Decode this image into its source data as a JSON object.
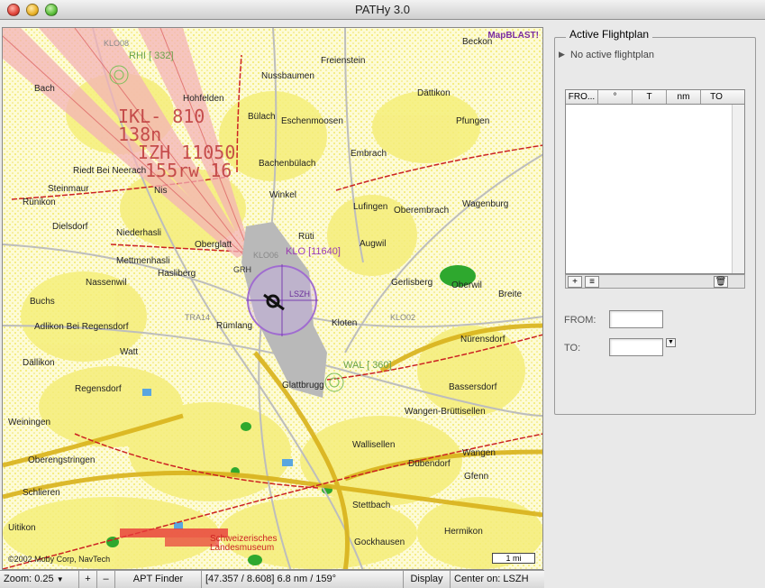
{
  "window": {
    "title": "PATHy 3.0"
  },
  "map": {
    "mapblast_logo": "MapBLAST!",
    "copyright": "©2002 Moby Corp, NavTech",
    "scale": "1 mi",
    "flight_labels": [
      "IKL- 810",
      "138n",
      "IZH 11050",
      "155rw 16"
    ],
    "navaids": [
      {
        "label": "RHI [ 332]"
      },
      {
        "label": "KLO [11640]"
      },
      {
        "label": "WAL [ 360]"
      }
    ],
    "waypoints": [
      "KLO08",
      "KLO06",
      "TRA14",
      "KLO02",
      "LSZH",
      "GRH"
    ],
    "places": [
      "Beckon",
      "Freienstein",
      "Nussbaumen",
      "Dättikon",
      "Bach",
      "Hohfelden",
      "Bülach",
      "Eschenmoosen",
      "Pfungen",
      "Embrach",
      "Riedt Bei Neerach",
      "Steinmaur",
      "Bachenbülach",
      "Nis",
      "Winkel",
      "Rünikon",
      "Lufingen",
      "Oberembrach",
      "Wagenburg",
      "Dielsdorf",
      "Niederhasli",
      "Oberglatt",
      "Rüti",
      "Augwil",
      "Mettmenhasli",
      "Nassenwil",
      "Hasliberg",
      "Oberwil",
      "Gerlisberg",
      "Breite",
      "Buchs",
      "Adlikon Bei Regensdorf",
      "Rümlang",
      "Kloten",
      "Watt",
      "Nürensdorf",
      "Dällikon",
      "Regensdorf",
      "Glattbrugg",
      "Bassersdorf",
      "Weiningen",
      "Wangen-Brüttisellen",
      "Wallisellen",
      "Wangen",
      "Oberengstringen",
      "Schlieren",
      "Dübendorf",
      "Gfenn",
      "Stettbach",
      "Hermikon",
      "Uitikon",
      "Schweizerisches Landesmuseum",
      "Gockhausen"
    ]
  },
  "statusbar": {
    "zoom": "Zoom: 0.25",
    "zoom_in": "+",
    "zoom_out": "–",
    "apt_finder": "APT Finder",
    "position": "[47.357 / 8.608] 6.8 nm / 159°",
    "display": "Display",
    "center": "Center on: LSZH"
  },
  "flightplan": {
    "title": "Active Flightplan",
    "status": "No active flightplan",
    "columns": [
      "FRO...",
      "°",
      "T",
      "nm",
      "TO"
    ],
    "add_btn": "+",
    "list_btn": "≡",
    "trash_btn": "🗑",
    "from_label": "FROM:",
    "to_label": "TO:"
  }
}
